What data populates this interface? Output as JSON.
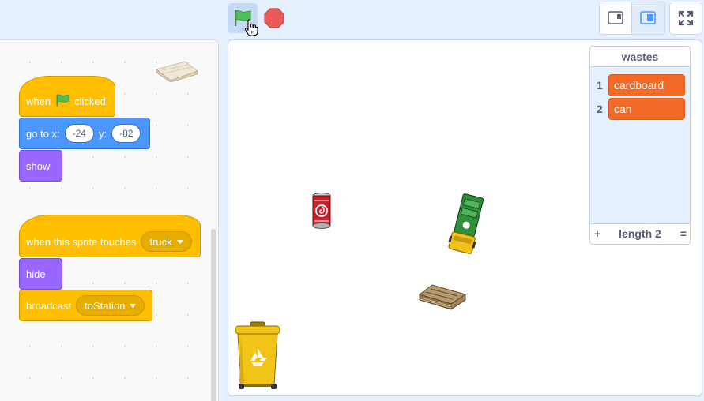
{
  "controls": {
    "green_flag_icon": "green-flag-icon",
    "stop_icon": "stop-sign-icon",
    "small_stage_icon": "small-stage-icon",
    "normal_stage_icon": "normal-stage-icon",
    "fullscreen_icon": "fullscreen-icon"
  },
  "scripts": {
    "script1": {
      "hat_when": "when",
      "hat_clicked": "clicked",
      "goto_label": "go to x:",
      "goto_x": "-24",
      "goto_y_label": "y:",
      "goto_y": "-82",
      "show": "show"
    },
    "script2": {
      "hat_label": "when this sprite touches",
      "hat_target": "truck",
      "hide": "hide",
      "broadcast_label": "broadcast",
      "broadcast_message": "toStation"
    }
  },
  "list_monitor": {
    "title": "wastes",
    "items": [
      {
        "index": "1",
        "value": "cardboard"
      },
      {
        "index": "2",
        "value": "can"
      }
    ],
    "add": "+",
    "length_label": "length 2",
    "resize": "="
  },
  "colors": {
    "events": "#ffbf00",
    "motion": "#4c97ff",
    "looks": "#9966ff",
    "list_item": "#f26a25",
    "stage_border": "#c8d3e5"
  }
}
